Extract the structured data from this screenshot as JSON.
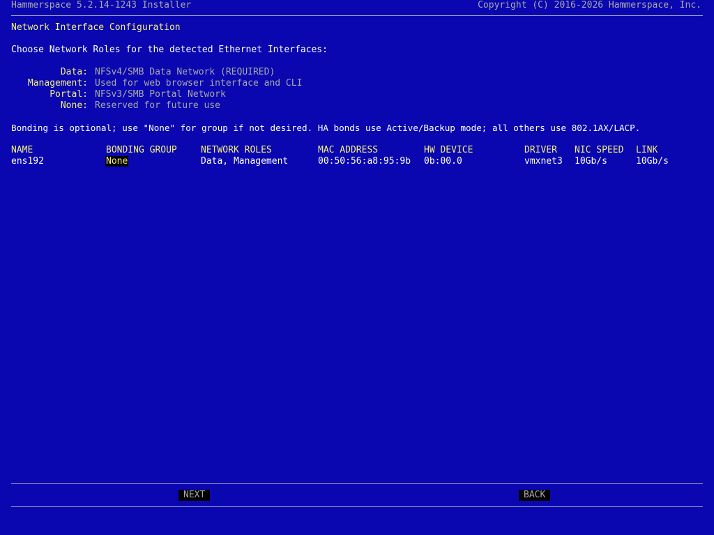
{
  "header": {
    "title": "Hammerspace 5.2.14-1243 Installer",
    "copyright": "Copyright (C) 2016-2026 Hammerspace, Inc."
  },
  "section_title": "Network Interface Configuration",
  "intro": "Choose Network Roles for the detected Ethernet Interfaces:",
  "roles": [
    {
      "label": "Data:",
      "description": "NFSv4/SMB Data Network (REQUIRED)"
    },
    {
      "label": "Management:",
      "description": "Used for web browser interface and CLI"
    },
    {
      "label": "Portal:",
      "description": "NFSv3/SMB Portal Network"
    },
    {
      "label": "None:",
      "description": "Reserved for future use"
    }
  ],
  "bonding_note": "Bonding is optional; use \"None\" for group if not desired. HA bonds use Active/Backup mode; all others use 802.1AX/LACP.",
  "table": {
    "headers": {
      "name": "NAME",
      "bonding_group": "BONDING GROUP",
      "network_roles": "NETWORK ROLES",
      "mac_address": "MAC ADDRESS",
      "hw_device": "HW DEVICE",
      "driver": "DRIVER",
      "nic_speed": "NIC SPEED",
      "link": "LINK"
    },
    "rows": [
      {
        "name": "ens192",
        "bonding_group": "None",
        "network_roles": "Data, Management",
        "mac_address": "00:50:56:a8:95:9b",
        "hw_device": "0b:00.0",
        "driver": "vmxnet3",
        "nic_speed": "10Gb/s",
        "link": "10Gb/s"
      }
    ]
  },
  "buttons": {
    "next": "NEXT",
    "back": "BACK"
  },
  "colors": {
    "background": "#0a07b0",
    "accent": "#f4f080",
    "muted": "#a8a8a8"
  }
}
